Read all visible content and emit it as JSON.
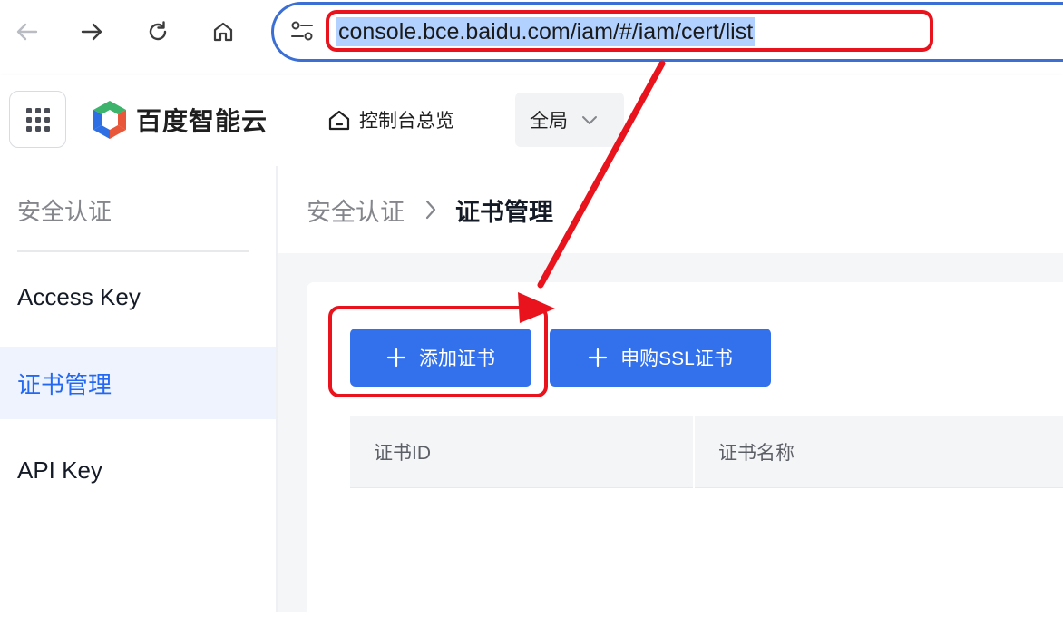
{
  "browser": {
    "url": "console.bce.baidu.com/iam/#/iam/cert/list"
  },
  "header": {
    "brand": "百度智能云",
    "dashboard_label": "控制台总览",
    "region_label": "全局"
  },
  "sidebar": {
    "title": "安全认证",
    "items": [
      {
        "label": "Access Key",
        "active": false
      },
      {
        "label": "证书管理",
        "active": true
      },
      {
        "label": "API Key",
        "active": false
      }
    ]
  },
  "breadcrumb": {
    "parent": "安全认证",
    "current": "证书管理"
  },
  "toolbar": {
    "add_cert_label": "添加证书",
    "buy_ssl_label": "申购SSL证书"
  },
  "table": {
    "columns": [
      "证书ID",
      "证书名称"
    ]
  },
  "colors": {
    "primary": "#3370eb",
    "annotation": "#e8131c",
    "active_text": "#2468f2"
  }
}
